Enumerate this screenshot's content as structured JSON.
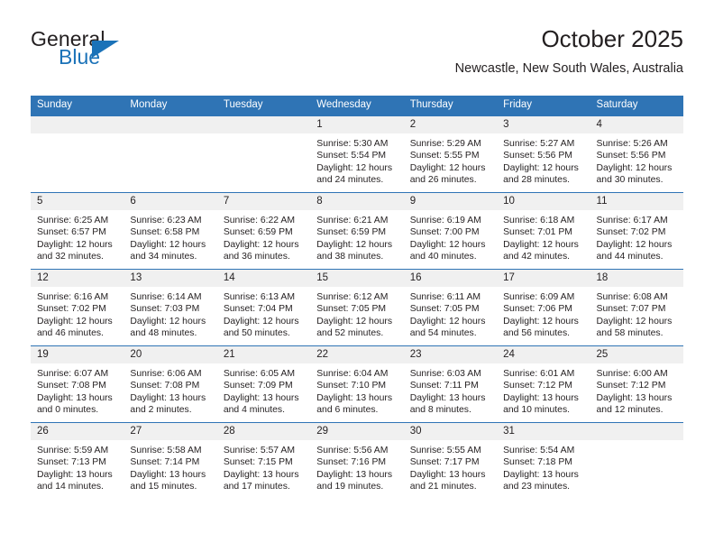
{
  "brand": {
    "name_top": "General",
    "name_bottom": "Blue",
    "accent_color": "#1b72b8"
  },
  "header": {
    "title": "October 2025",
    "subtitle": "Newcastle, New South Wales, Australia"
  },
  "theme": {
    "header_blue": "#2f74b5",
    "daynum_band": "#f0f0f0",
    "text": "#231f20"
  },
  "calendar": {
    "weekday_headers": [
      "Sunday",
      "Monday",
      "Tuesday",
      "Wednesday",
      "Thursday",
      "Friday",
      "Saturday"
    ],
    "labels": {
      "sunrise": "Sunrise:",
      "sunset": "Sunset:",
      "daylight": "Daylight:"
    },
    "weeks": [
      [
        {
          "day": ""
        },
        {
          "day": ""
        },
        {
          "day": ""
        },
        {
          "day": "1",
          "sunrise": "Sunrise: 5:30 AM",
          "sunset": "Sunset: 5:54 PM",
          "daylight_1": "Daylight: 12 hours",
          "daylight_2": "and 24 minutes."
        },
        {
          "day": "2",
          "sunrise": "Sunrise: 5:29 AM",
          "sunset": "Sunset: 5:55 PM",
          "daylight_1": "Daylight: 12 hours",
          "daylight_2": "and 26 minutes."
        },
        {
          "day": "3",
          "sunrise": "Sunrise: 5:27 AM",
          "sunset": "Sunset: 5:56 PM",
          "daylight_1": "Daylight: 12 hours",
          "daylight_2": "and 28 minutes."
        },
        {
          "day": "4",
          "sunrise": "Sunrise: 5:26 AM",
          "sunset": "Sunset: 5:56 PM",
          "daylight_1": "Daylight: 12 hours",
          "daylight_2": "and 30 minutes."
        }
      ],
      [
        {
          "day": "5",
          "sunrise": "Sunrise: 6:25 AM",
          "sunset": "Sunset: 6:57 PM",
          "daylight_1": "Daylight: 12 hours",
          "daylight_2": "and 32 minutes."
        },
        {
          "day": "6",
          "sunrise": "Sunrise: 6:23 AM",
          "sunset": "Sunset: 6:58 PM",
          "daylight_1": "Daylight: 12 hours",
          "daylight_2": "and 34 minutes."
        },
        {
          "day": "7",
          "sunrise": "Sunrise: 6:22 AM",
          "sunset": "Sunset: 6:59 PM",
          "daylight_1": "Daylight: 12 hours",
          "daylight_2": "and 36 minutes."
        },
        {
          "day": "8",
          "sunrise": "Sunrise: 6:21 AM",
          "sunset": "Sunset: 6:59 PM",
          "daylight_1": "Daylight: 12 hours",
          "daylight_2": "and 38 minutes."
        },
        {
          "day": "9",
          "sunrise": "Sunrise: 6:19 AM",
          "sunset": "Sunset: 7:00 PM",
          "daylight_1": "Daylight: 12 hours",
          "daylight_2": "and 40 minutes."
        },
        {
          "day": "10",
          "sunrise": "Sunrise: 6:18 AM",
          "sunset": "Sunset: 7:01 PM",
          "daylight_1": "Daylight: 12 hours",
          "daylight_2": "and 42 minutes."
        },
        {
          "day": "11",
          "sunrise": "Sunrise: 6:17 AM",
          "sunset": "Sunset: 7:02 PM",
          "daylight_1": "Daylight: 12 hours",
          "daylight_2": "and 44 minutes."
        }
      ],
      [
        {
          "day": "12",
          "sunrise": "Sunrise: 6:16 AM",
          "sunset": "Sunset: 7:02 PM",
          "daylight_1": "Daylight: 12 hours",
          "daylight_2": "and 46 minutes."
        },
        {
          "day": "13",
          "sunrise": "Sunrise: 6:14 AM",
          "sunset": "Sunset: 7:03 PM",
          "daylight_1": "Daylight: 12 hours",
          "daylight_2": "and 48 minutes."
        },
        {
          "day": "14",
          "sunrise": "Sunrise: 6:13 AM",
          "sunset": "Sunset: 7:04 PM",
          "daylight_1": "Daylight: 12 hours",
          "daylight_2": "and 50 minutes."
        },
        {
          "day": "15",
          "sunrise": "Sunrise: 6:12 AM",
          "sunset": "Sunset: 7:05 PM",
          "daylight_1": "Daylight: 12 hours",
          "daylight_2": "and 52 minutes."
        },
        {
          "day": "16",
          "sunrise": "Sunrise: 6:11 AM",
          "sunset": "Sunset: 7:05 PM",
          "daylight_1": "Daylight: 12 hours",
          "daylight_2": "and 54 minutes."
        },
        {
          "day": "17",
          "sunrise": "Sunrise: 6:09 AM",
          "sunset": "Sunset: 7:06 PM",
          "daylight_1": "Daylight: 12 hours",
          "daylight_2": "and 56 minutes."
        },
        {
          "day": "18",
          "sunrise": "Sunrise: 6:08 AM",
          "sunset": "Sunset: 7:07 PM",
          "daylight_1": "Daylight: 12 hours",
          "daylight_2": "and 58 minutes."
        }
      ],
      [
        {
          "day": "19",
          "sunrise": "Sunrise: 6:07 AM",
          "sunset": "Sunset: 7:08 PM",
          "daylight_1": "Daylight: 13 hours",
          "daylight_2": "and 0 minutes."
        },
        {
          "day": "20",
          "sunrise": "Sunrise: 6:06 AM",
          "sunset": "Sunset: 7:08 PM",
          "daylight_1": "Daylight: 13 hours",
          "daylight_2": "and 2 minutes."
        },
        {
          "day": "21",
          "sunrise": "Sunrise: 6:05 AM",
          "sunset": "Sunset: 7:09 PM",
          "daylight_1": "Daylight: 13 hours",
          "daylight_2": "and 4 minutes."
        },
        {
          "day": "22",
          "sunrise": "Sunrise: 6:04 AM",
          "sunset": "Sunset: 7:10 PM",
          "daylight_1": "Daylight: 13 hours",
          "daylight_2": "and 6 minutes."
        },
        {
          "day": "23",
          "sunrise": "Sunrise: 6:03 AM",
          "sunset": "Sunset: 7:11 PM",
          "daylight_1": "Daylight: 13 hours",
          "daylight_2": "and 8 minutes."
        },
        {
          "day": "24",
          "sunrise": "Sunrise: 6:01 AM",
          "sunset": "Sunset: 7:12 PM",
          "daylight_1": "Daylight: 13 hours",
          "daylight_2": "and 10 minutes."
        },
        {
          "day": "25",
          "sunrise": "Sunrise: 6:00 AM",
          "sunset": "Sunset: 7:12 PM",
          "daylight_1": "Daylight: 13 hours",
          "daylight_2": "and 12 minutes."
        }
      ],
      [
        {
          "day": "26",
          "sunrise": "Sunrise: 5:59 AM",
          "sunset": "Sunset: 7:13 PM",
          "daylight_1": "Daylight: 13 hours",
          "daylight_2": "and 14 minutes."
        },
        {
          "day": "27",
          "sunrise": "Sunrise: 5:58 AM",
          "sunset": "Sunset: 7:14 PM",
          "daylight_1": "Daylight: 13 hours",
          "daylight_2": "and 15 minutes."
        },
        {
          "day": "28",
          "sunrise": "Sunrise: 5:57 AM",
          "sunset": "Sunset: 7:15 PM",
          "daylight_1": "Daylight: 13 hours",
          "daylight_2": "and 17 minutes."
        },
        {
          "day": "29",
          "sunrise": "Sunrise: 5:56 AM",
          "sunset": "Sunset: 7:16 PM",
          "daylight_1": "Daylight: 13 hours",
          "daylight_2": "and 19 minutes."
        },
        {
          "day": "30",
          "sunrise": "Sunrise: 5:55 AM",
          "sunset": "Sunset: 7:17 PM",
          "daylight_1": "Daylight: 13 hours",
          "daylight_2": "and 21 minutes."
        },
        {
          "day": "31",
          "sunrise": "Sunrise: 5:54 AM",
          "sunset": "Sunset: 7:18 PM",
          "daylight_1": "Daylight: 13 hours",
          "daylight_2": "and 23 minutes."
        },
        {
          "day": ""
        }
      ]
    ]
  }
}
